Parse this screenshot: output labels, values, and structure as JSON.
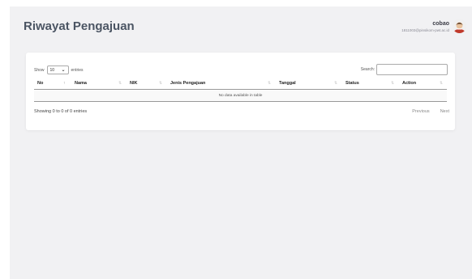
{
  "header": {
    "title": "Riwayat Pengajuan",
    "user_name": "cobao",
    "user_email": "1811003@pinsikom-pwt.ac.id"
  },
  "table": {
    "length_label_pre": "Show",
    "length_value": "10",
    "length_label_post": "entries",
    "search_label": "Search:",
    "search_placeholder": "",
    "columns": [
      "No",
      "Nama",
      "NIK",
      "Jenis Pengajuan",
      "Tanggal",
      "Status",
      "Action"
    ],
    "empty_message": "No data available in table",
    "info": "Showing 0 to 0 of 0 entries",
    "prev_label": "Previous",
    "next_label": "Next"
  },
  "icons": {
    "avatar": "avatar-icon",
    "sort": "sort-arrows-icon",
    "dropdown": "chevron-down-icon"
  },
  "colors": {
    "background": "#f1f1f3",
    "card": "#ffffff",
    "title": "#4b5563"
  }
}
